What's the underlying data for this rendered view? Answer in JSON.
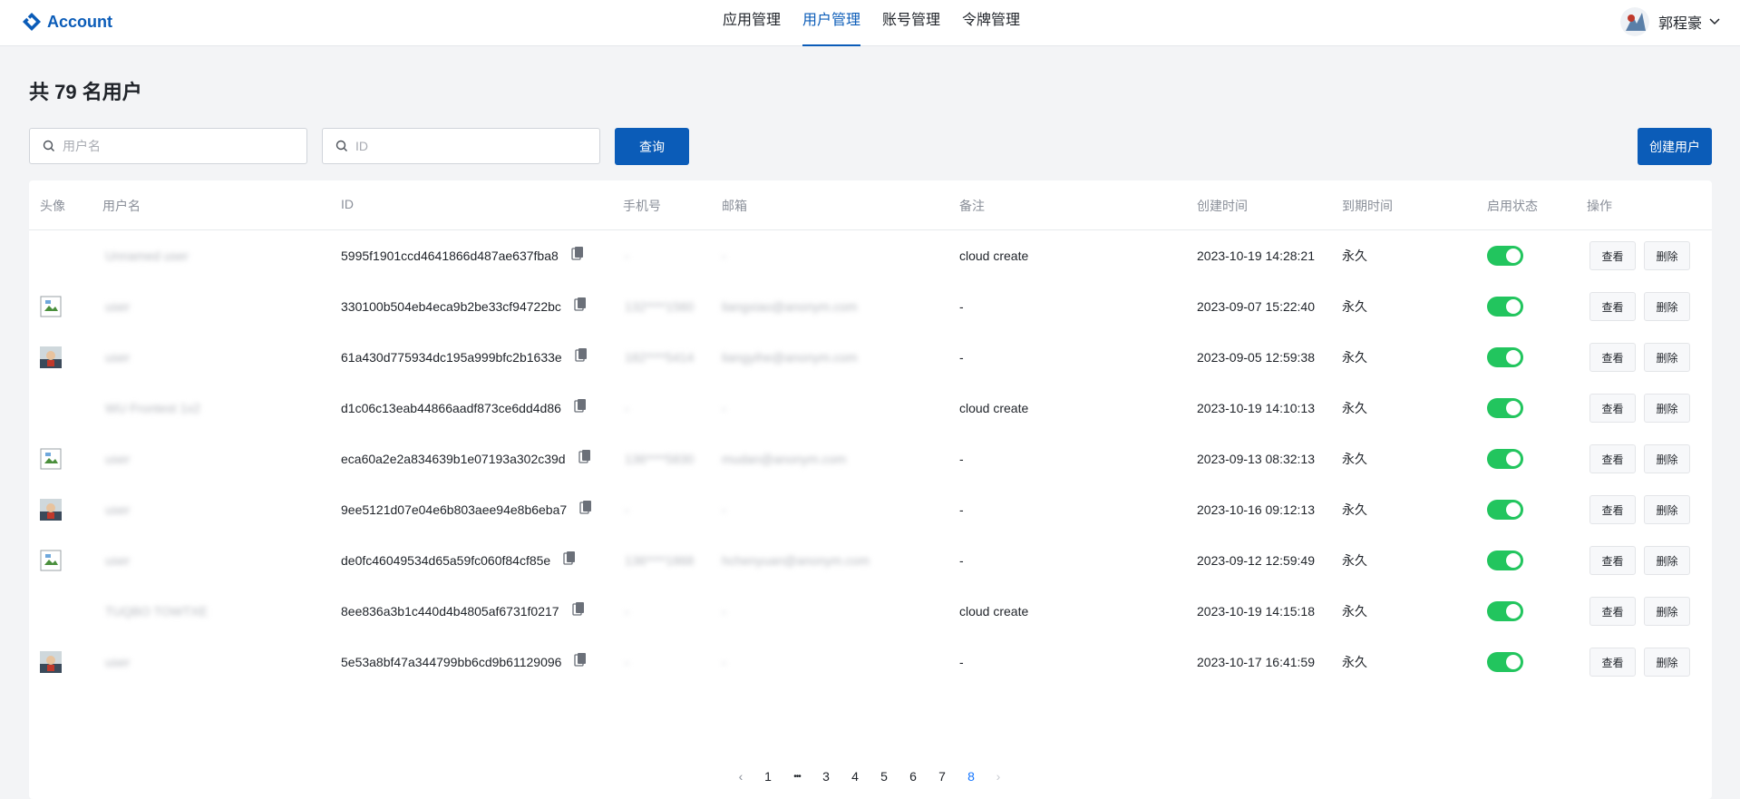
{
  "header": {
    "brand": "Account",
    "nav": [
      {
        "label": "应用管理",
        "active": false
      },
      {
        "label": "用户管理",
        "active": true
      },
      {
        "label": "账号管理",
        "active": false
      },
      {
        "label": "令牌管理",
        "active": false
      }
    ],
    "user_name": "郭程豪"
  },
  "page_title": "共 79 名用户",
  "search": {
    "username_placeholder": "用户名",
    "id_placeholder": "ID",
    "query_button": "查询",
    "create_button": "创建用户"
  },
  "table": {
    "columns": [
      "头像",
      "用户名",
      "ID",
      "手机号",
      "邮箱",
      "备注",
      "创建时间",
      "到期时间",
      "启用状态",
      "操作"
    ],
    "rows": [
      {
        "avatar": "none",
        "username": "Unnamed user",
        "id": "5995f1901ccd4641866d487ae637fba8",
        "phone": "-",
        "email": "-",
        "note": "cloud create",
        "created": "2023-10-19 14:28:21",
        "expires": "永久",
        "enabled": true
      },
      {
        "avatar": "broken",
        "username": "user",
        "id": "330100b504eb4eca9b2be33cf94722bc",
        "phone": "132****1560",
        "email": "liangxiao@anonym.com",
        "note": "-",
        "created": "2023-09-07 15:22:40",
        "expires": "永久",
        "enabled": true
      },
      {
        "avatar": "photo",
        "username": "user",
        "id": "61a430d775934dc195a999bfc2b1633e",
        "phone": "182****5414",
        "email": "liangyihe@anonym.com",
        "note": "-",
        "created": "2023-09-05 12:59:38",
        "expires": "永久",
        "enabled": true
      },
      {
        "avatar": "none",
        "username": "WU Frontest 1x2",
        "id": "d1c06c13eab44866aadf873ce6dd4d86",
        "phone": "-",
        "email": "-",
        "note": "cloud create",
        "created": "2023-10-19 14:10:13",
        "expires": "永久",
        "enabled": true
      },
      {
        "avatar": "broken",
        "username": "user",
        "id": "eca60a2e2a834639b1e07193a302c39d",
        "phone": "136****5830",
        "email": "mudan@anonym.com",
        "note": "-",
        "created": "2023-09-13 08:32:13",
        "expires": "永久",
        "enabled": true
      },
      {
        "avatar": "photo",
        "username": "user",
        "id": "9ee5121d07e04e6b803aee94e8b6eba7",
        "phone": "-",
        "email": "-",
        "note": "-",
        "created": "2023-10-16 09:12:13",
        "expires": "永久",
        "enabled": true
      },
      {
        "avatar": "broken",
        "username": "user",
        "id": "de0fc46049534d65a59fc060f84cf85e",
        "phone": "136****1868",
        "email": "hchenyuan@anonym.com",
        "note": "-",
        "created": "2023-09-12 12:59:49",
        "expires": "永久",
        "enabled": true
      },
      {
        "avatar": "none",
        "username": "TUQBO TOWTXE",
        "id": "8ee836a3b1c440d4b4805af6731f0217",
        "phone": "-",
        "email": "-",
        "note": "cloud create",
        "created": "2023-10-19 14:15:18",
        "expires": "永久",
        "enabled": true
      },
      {
        "avatar": "photo",
        "username": "user",
        "id": "5e53a8bf47a344799bb6cd9b61129096",
        "phone": "-",
        "email": "-",
        "note": "-",
        "created": "2023-10-17 16:41:59",
        "expires": "永久",
        "enabled": true
      }
    ],
    "actions": {
      "view": "查看",
      "delete": "删除"
    }
  },
  "pagination": {
    "prev": "‹",
    "next": "›",
    "ellipsis": "•••",
    "pages": [
      "1",
      "3",
      "4",
      "5",
      "6",
      "7",
      "8"
    ],
    "current": "8"
  },
  "colors": {
    "accent": "#0b5cb8",
    "toggle_on": "#22c55e",
    "page_active": "#1677ff"
  }
}
